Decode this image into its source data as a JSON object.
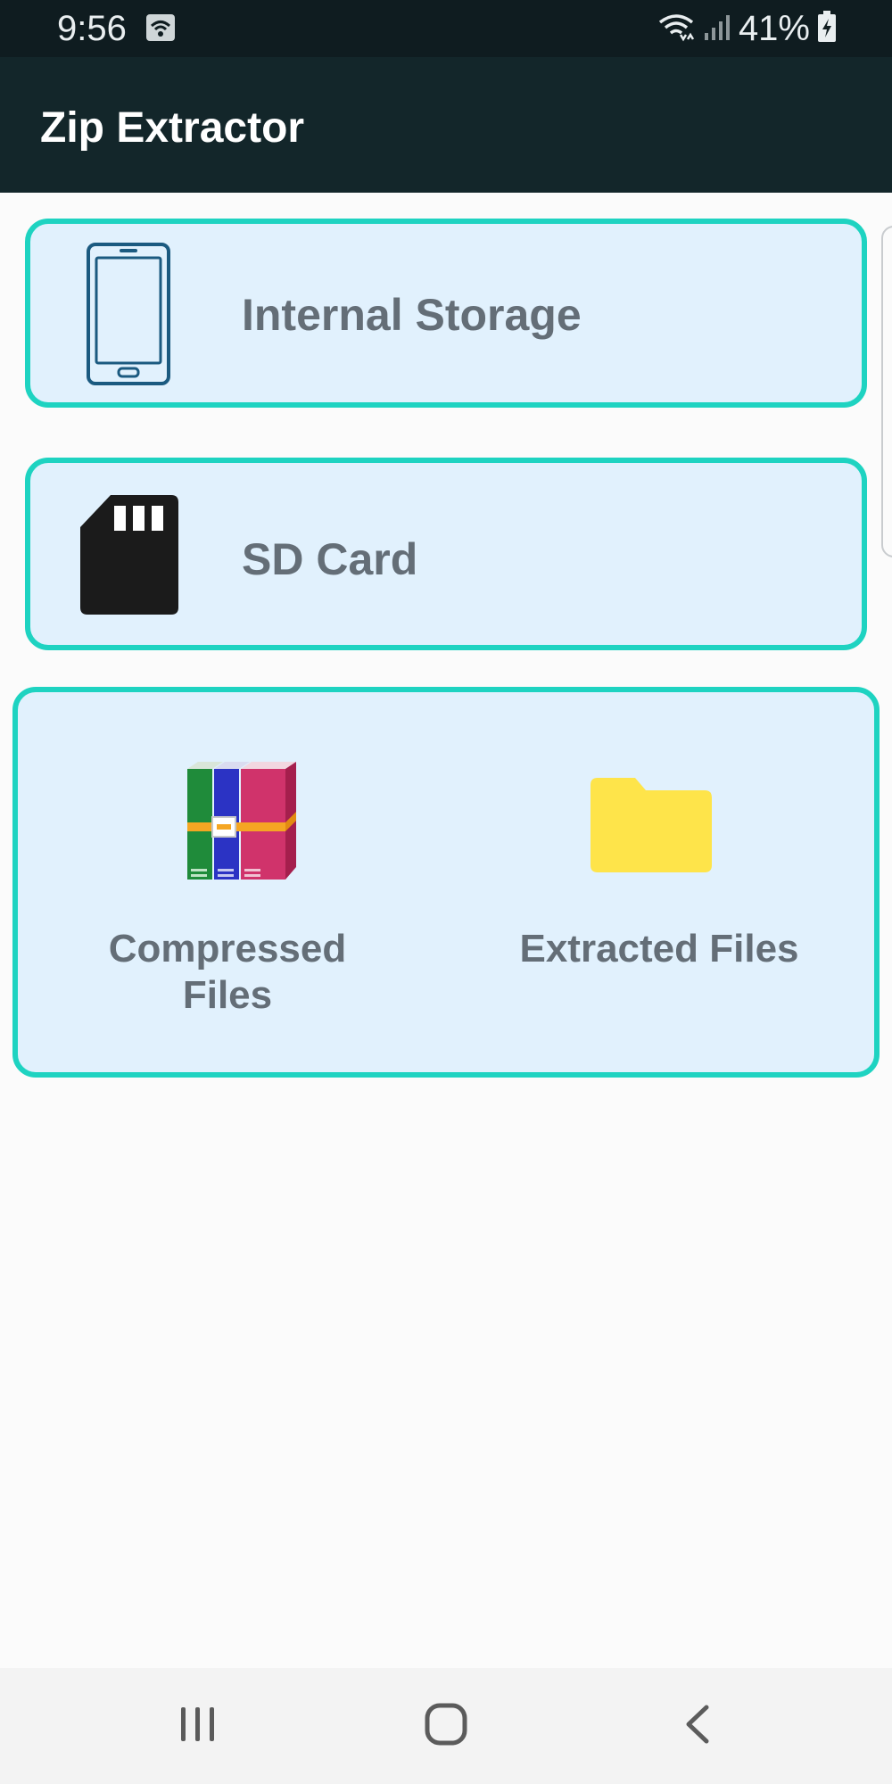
{
  "status_bar": {
    "time": "9:56",
    "battery": "41%"
  },
  "app_bar": {
    "title": "Zip Extractor"
  },
  "storage": {
    "internal_label": "Internal Storage",
    "sd_label": "SD Card"
  },
  "quick_access": {
    "compressed_label_line1": "Compressed",
    "compressed_label_line2": "Files",
    "extracted_label": "Extracted Files"
  },
  "icons": {
    "phone": "phone-icon",
    "sd": "sd-card-icon",
    "archive": "archive-books-icon",
    "folder": "folder-icon",
    "recents": "recents-icon",
    "home": "home-icon",
    "back": "back-icon"
  },
  "colors": {
    "accent_border": "#1ed3c1",
    "card_bg": "#e1f1fd",
    "app_bar_bg": "#13262a",
    "label_text": "#646e77",
    "folder": "#fee44a"
  }
}
